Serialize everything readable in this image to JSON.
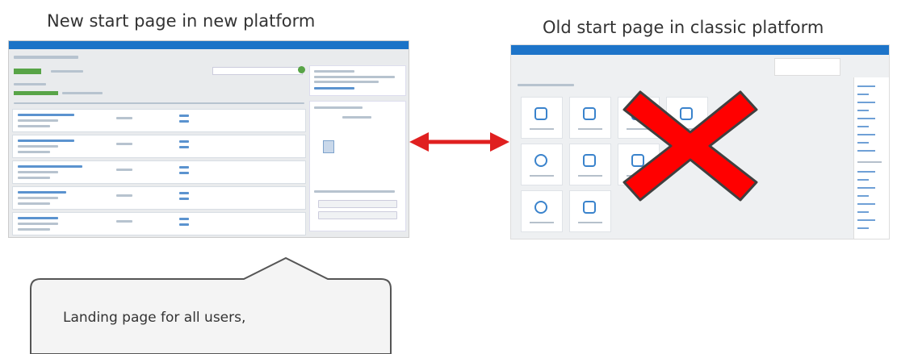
{
  "titles": {
    "new": "New start page in new platform",
    "old": "Old start page in classic platform"
  },
  "callout": {
    "text": "Landing page for all users,"
  },
  "colors": {
    "arrow": "#e02020",
    "cross": "#ff0000",
    "platform_blue": "#1b73c7",
    "accent_green": "#58a447"
  },
  "icons": {
    "arrow": "double-headed-arrow",
    "cross": "red-x-cross"
  }
}
